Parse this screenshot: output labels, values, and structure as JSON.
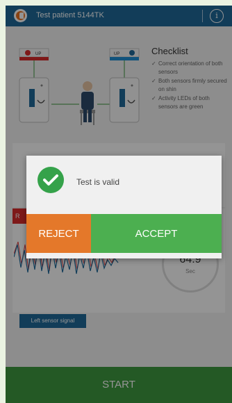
{
  "app": {
    "title": "Test patient 5144TK"
  },
  "checklist": {
    "title": "Checklist",
    "items": [
      "Correct orientation of both sensors",
      "Both sensors firmly secured on shin",
      "Activity LEDs of both sensors are green"
    ]
  },
  "diagram": {
    "left_sensor_tag": "UP",
    "right_sensor_tag": "UP"
  },
  "timer": {
    "value": "64.9",
    "unit": "Sec"
  },
  "signal": {
    "left_label": "Left sensor signal",
    "tab_initial": "R"
  },
  "dialog": {
    "message": "Test is valid",
    "reject_label": "REJECT",
    "accept_label": "ACCEPT"
  },
  "footer": {
    "start_label": "START"
  },
  "colors": {
    "app_bar": "#1f6a9a",
    "accept": "#4caf50",
    "reject": "#e4782a",
    "start": "#3e9a40",
    "valid_icon": "#35a24a",
    "signal_line": "#1f6a9a",
    "signal_line_alt": "#e03c3c"
  },
  "icons": [
    "app-logo-icon",
    "info-icon",
    "checkmark-icon",
    "check-circle-icon"
  ]
}
